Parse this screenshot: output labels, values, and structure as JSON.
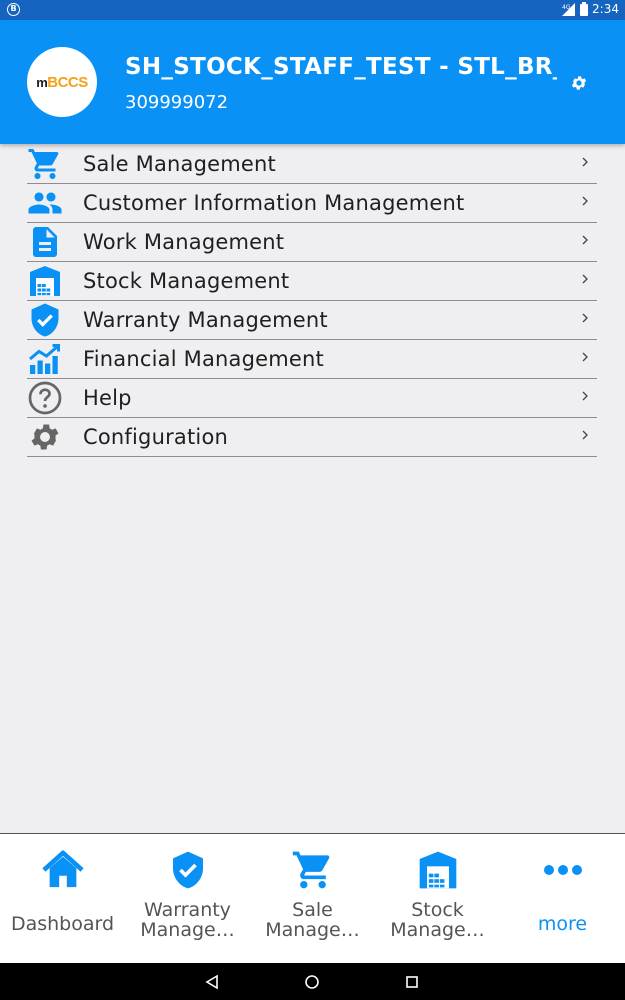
{
  "status_bar": {
    "badge": "B",
    "time": "2:34"
  },
  "header": {
    "logo": {
      "prefix": "m",
      "brand": "BCCS"
    },
    "user_name": "SH_STOCK_STAFF_TEST - STL_BR_",
    "phone": "309999072"
  },
  "menu": {
    "items": [
      {
        "label": "Sale Management",
        "icon": "shopping-cart-icon"
      },
      {
        "label": "Customer Information Management",
        "icon": "people-icon"
      },
      {
        "label": "Work Management",
        "icon": "document-icon"
      },
      {
        "label": "Stock Management",
        "icon": "warehouse-icon"
      },
      {
        "label": "Warranty Management",
        "icon": "shield-check-icon"
      },
      {
        "label": "Financial Management",
        "icon": "chart-icon"
      },
      {
        "label": "Help",
        "icon": "help-icon"
      },
      {
        "label": "Configuration",
        "icon": "gear-icon"
      }
    ]
  },
  "bottom_nav": {
    "items": [
      {
        "label": "Dashboard",
        "icon": "home-icon"
      },
      {
        "line1": "Warranty",
        "line2": "Manage…",
        "icon": "shield-check-icon"
      },
      {
        "line1": "Sale",
        "line2": "Manage…",
        "icon": "shopping-cart-icon"
      },
      {
        "line1": "Stock",
        "line2": "Manage…",
        "icon": "warehouse-icon"
      },
      {
        "label": "more",
        "icon": "more-icon"
      }
    ]
  },
  "colors": {
    "header_bg": "#0a91f6",
    "status_bg": "#1565c0",
    "icon_blue": "#0a91f6",
    "accent_link": "#0a91f6"
  }
}
